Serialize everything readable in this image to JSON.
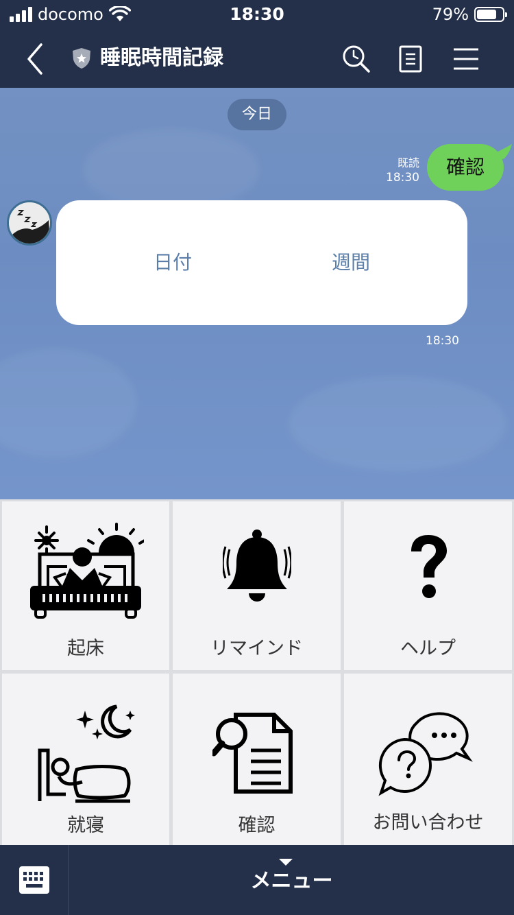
{
  "status_bar": {
    "carrier": "docomo",
    "time": "18:30",
    "battery_percent_text": "79%",
    "battery_level": 0.79
  },
  "header": {
    "title": "睡眠時間記録",
    "icons": [
      "back-chevron-icon",
      "shield-star-icon",
      "search-icon",
      "notes-icon",
      "hamburger-menu-icon"
    ]
  },
  "chat": {
    "date_separator": "今日",
    "sent_message": {
      "text": "確認",
      "read_label": "既読",
      "time": "18:30"
    },
    "card": {
      "options": [
        "日付",
        "週間"
      ],
      "time": "18:30"
    }
  },
  "rich_menu": {
    "items": [
      {
        "label": "起床",
        "icon": "wake-up-bed-sun-icon"
      },
      {
        "label": "リマインド",
        "icon": "bell-icon"
      },
      {
        "label": "ヘルプ",
        "icon": "question-mark-icon"
      },
      {
        "label": "就寝",
        "icon": "sleep-moon-stars-icon"
      },
      {
        "label": "確認",
        "icon": "document-search-icon"
      },
      {
        "label": "お問い合わせ",
        "icon": "chat-question-bubbles-icon"
      }
    ]
  },
  "bottom_bar": {
    "menu_label": "メニュー",
    "keyboard_icon": "keyboard-icon"
  },
  "colors": {
    "header_bg": "#24304a",
    "chat_bg": "#7391c2",
    "sent_bubble": "#6fd05a",
    "card_link": "#5b7ea8",
    "tile_bg": "#f3f3f5"
  }
}
